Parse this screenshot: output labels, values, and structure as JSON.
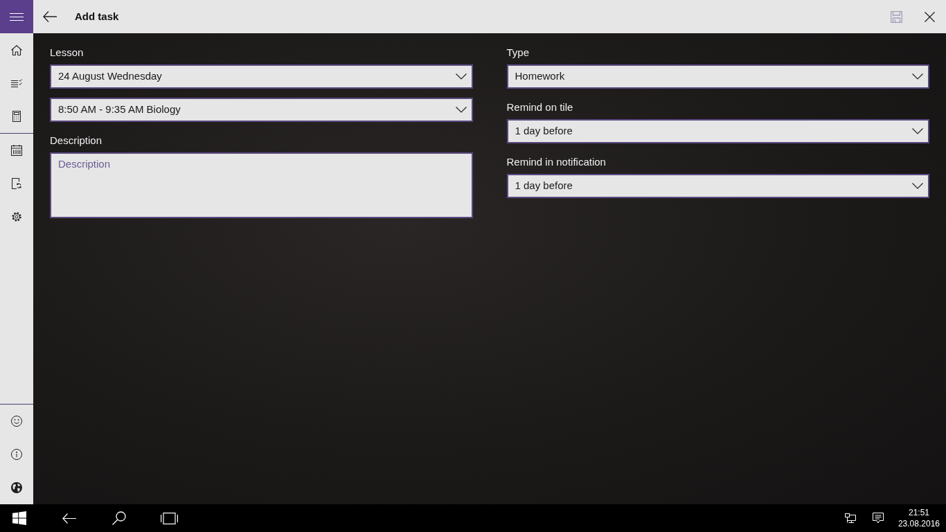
{
  "header": {
    "title": "Add task",
    "save_button": {
      "disabled": true
    }
  },
  "form": {
    "left_column": [
      {
        "kind": "dropdown",
        "label": "Lesson",
        "value": "24 August Wednesday"
      },
      {
        "kind": "dropdown",
        "value": "8:50 AM - 9:35 AM Biology"
      },
      {
        "kind": "textarea",
        "label": "Description",
        "placeholder": "Description"
      }
    ],
    "right_column": [
      {
        "kind": "dropdown",
        "label": "Type",
        "value": "Homework"
      },
      {
        "kind": "dropdown",
        "label": "Remind on tile",
        "value": "1 day before"
      },
      {
        "kind": "dropdown",
        "label": "Remind in notification",
        "value": "1 day before"
      }
    ]
  },
  "taskbar": {
    "time": "21:51",
    "date": "23.08.2016"
  }
}
